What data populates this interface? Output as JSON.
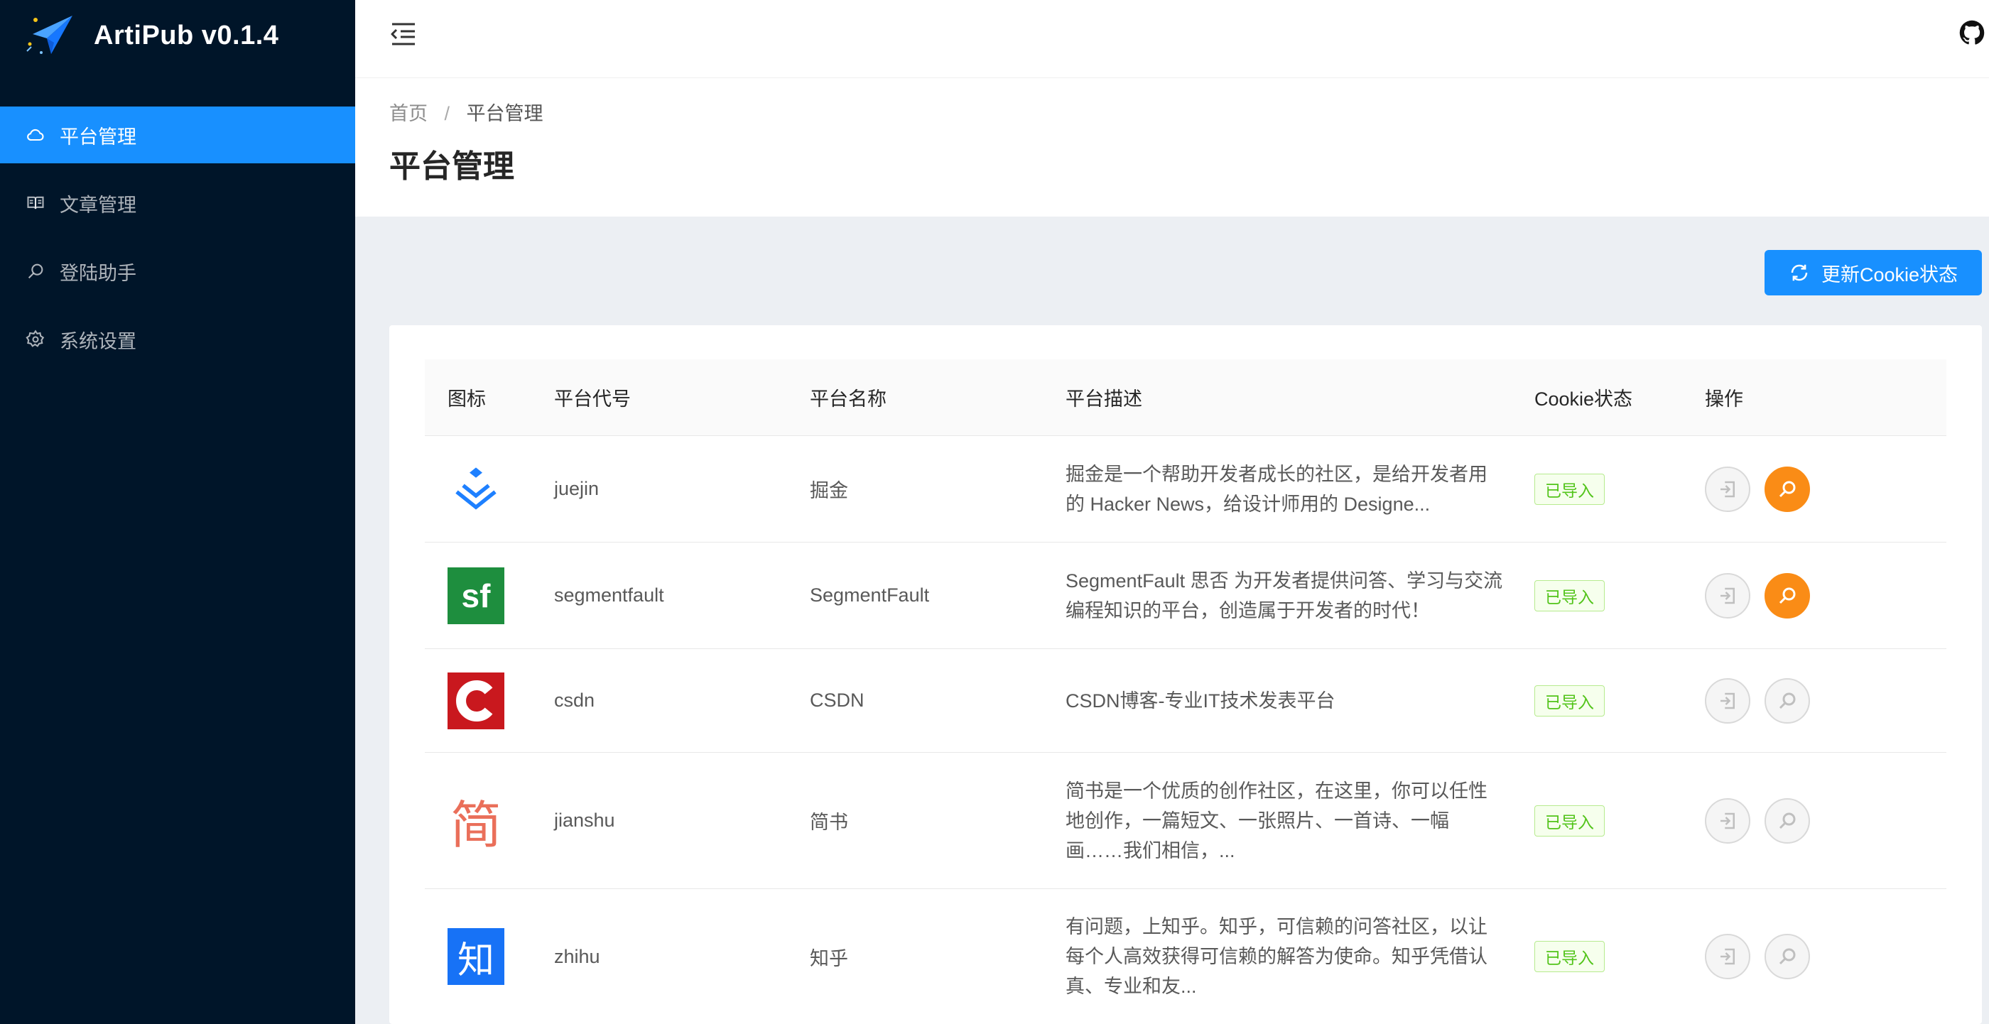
{
  "app": {
    "title": "ArtiPub v0.1.4"
  },
  "sidebar": {
    "items": [
      {
        "label": "平台管理",
        "icon": "cloud-icon",
        "active": true
      },
      {
        "label": "文章管理",
        "icon": "book-icon",
        "active": false
      },
      {
        "label": "登陆助手",
        "icon": "search-icon",
        "active": false
      },
      {
        "label": "系统设置",
        "icon": "gear-icon",
        "active": false
      }
    ]
  },
  "breadcrumb": {
    "home": "首页",
    "separator": "/",
    "current": "平台管理"
  },
  "page": {
    "title": "平台管理"
  },
  "actions": {
    "refresh_label": "更新Cookie状态"
  },
  "table": {
    "headers": {
      "icon": "图标",
      "code": "平台代号",
      "name": "平台名称",
      "desc": "平台描述",
      "cookie": "Cookie状态",
      "ops": "操作"
    },
    "rows": [
      {
        "code": "juejin",
        "name": "掘金",
        "desc": "掘金是一个帮助开发者成长的社区，是给开发者用的 Hacker News，给设计师用的 Designe...",
        "cookie": "已导入",
        "logo_text": "",
        "login_active": true
      },
      {
        "code": "segmentfault",
        "name": "SegmentFault",
        "desc": "SegmentFault 思否 为开发者提供问答、学习与交流编程知识的平台，创造属于开发者的时代！",
        "cookie": "已导入",
        "logo_text": "sf",
        "login_active": true
      },
      {
        "code": "csdn",
        "name": "CSDN",
        "desc": "CSDN博客-专业IT技术发表平台",
        "cookie": "已导入",
        "logo_text": "",
        "login_active": false
      },
      {
        "code": "jianshu",
        "name": "简书",
        "desc": "简书是一个优质的创作社区，在这里，你可以任性地创作，一篇短文、一张照片、一首诗、一幅画……我们相信，...",
        "cookie": "已导入",
        "logo_text": "简",
        "login_active": false
      },
      {
        "code": "zhihu",
        "name": "知乎",
        "desc": "有问题，上知乎。知乎，可信赖的问答社区，以让每个人高效获得可信赖的解答为使命。知乎凭借认真、专业和友...",
        "cookie": "已导入",
        "logo_text": "知",
        "login_active": false
      }
    ]
  },
  "colors": {
    "sidebar_bg": "#001529",
    "primary": "#1890ff",
    "success": "#52c41a",
    "orange": "#fa8c16"
  }
}
